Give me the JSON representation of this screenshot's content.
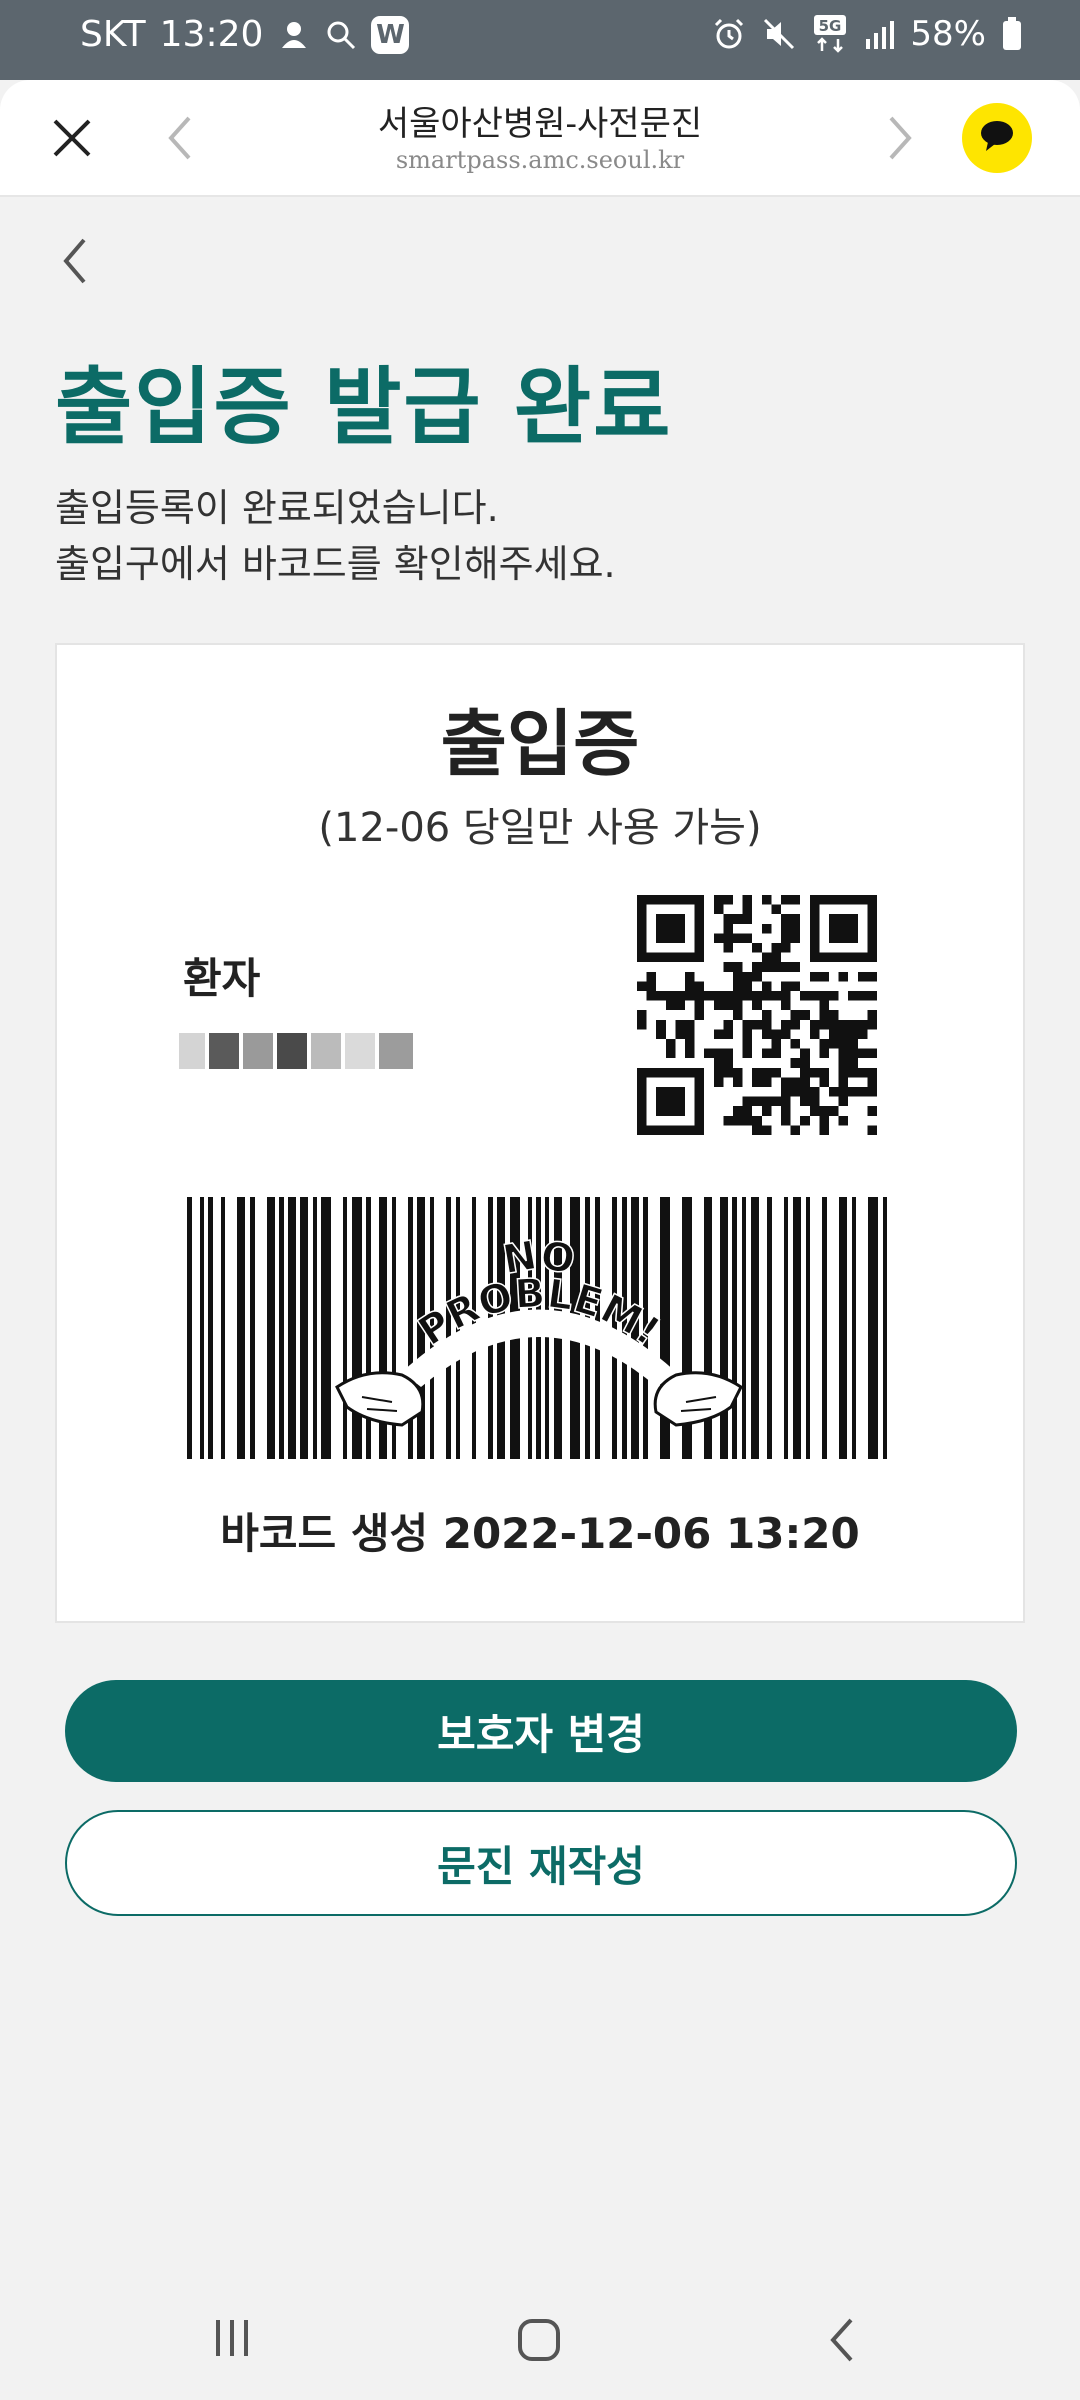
{
  "status_bar": {
    "carrier": "SKT",
    "time": "13:20",
    "network": "5G",
    "battery": "58%",
    "app_badge": "W",
    "icons": [
      "android-head-icon",
      "search-icon",
      "w-app-icon",
      "alarm-icon",
      "mute-icon",
      "5g-icon",
      "signal-icon",
      "battery-icon"
    ]
  },
  "browser": {
    "title": "서울아산병원-사전문진",
    "url": "smartpass.amc.seoul.kr",
    "kakao_color": "#fee500"
  },
  "page": {
    "title": "출입증 발급 완료",
    "subtitle_line1": "출입등록이 완료되었습니다.",
    "subtitle_line2": "출입구에서 바코드를 확인해주세요."
  },
  "pass": {
    "title": "출입증",
    "validity": "(12-06 당일만 사용 가능)",
    "patient_label": "환자",
    "barcode_caption": "바코드 생성 2022-12-06 13:20",
    "sticker_text": "NO PROBLEM!"
  },
  "buttons": {
    "change_guardian": "보호자 변경",
    "rewrite_questionnaire": "문진 재작성"
  },
  "colors": {
    "accent": "#0c6b66",
    "status_bar": "#5c666e",
    "background": "#f2f2f2"
  }
}
